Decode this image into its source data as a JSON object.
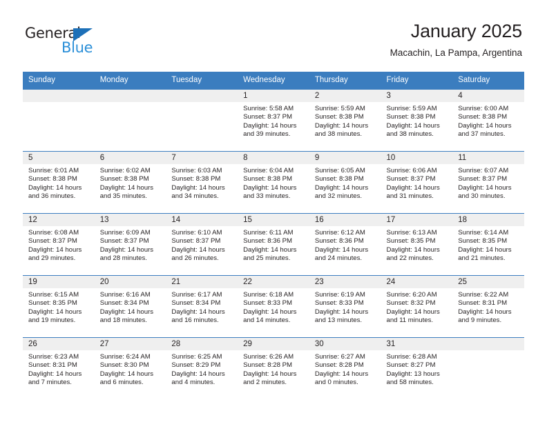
{
  "brand": {
    "name_part1": "General",
    "name_part2": "Blue",
    "triangle_icon": "triangle-icon",
    "color_black": "#231f20",
    "color_blue": "#2b8fd8"
  },
  "header": {
    "title": "January 2025",
    "subtitle": "Macachin, La Pampa, Argentina"
  },
  "theme": {
    "header_bg": "#3b7dbf",
    "header_text": "#ffffff",
    "daynum_bg": "#efefef",
    "cell_bg": "#ffffff",
    "text": "#231f20"
  },
  "weekday_headers": [
    "Sunday",
    "Monday",
    "Tuesday",
    "Wednesday",
    "Thursday",
    "Friday",
    "Saturday"
  ],
  "weeks": [
    [
      {
        "day": "",
        "sunrise": "",
        "sunset": "",
        "daylight": "",
        "empty": true
      },
      {
        "day": "",
        "sunrise": "",
        "sunset": "",
        "daylight": "",
        "empty": true
      },
      {
        "day": "",
        "sunrise": "",
        "sunset": "",
        "daylight": "",
        "empty": true
      },
      {
        "day": "1",
        "sunrise": "Sunrise: 5:58 AM",
        "sunset": "Sunset: 8:37 PM",
        "daylight": "Daylight: 14 hours and 39 minutes."
      },
      {
        "day": "2",
        "sunrise": "Sunrise: 5:59 AM",
        "sunset": "Sunset: 8:38 PM",
        "daylight": "Daylight: 14 hours and 38 minutes."
      },
      {
        "day": "3",
        "sunrise": "Sunrise: 5:59 AM",
        "sunset": "Sunset: 8:38 PM",
        "daylight": "Daylight: 14 hours and 38 minutes."
      },
      {
        "day": "4",
        "sunrise": "Sunrise: 6:00 AM",
        "sunset": "Sunset: 8:38 PM",
        "daylight": "Daylight: 14 hours and 37 minutes."
      }
    ],
    [
      {
        "day": "5",
        "sunrise": "Sunrise: 6:01 AM",
        "sunset": "Sunset: 8:38 PM",
        "daylight": "Daylight: 14 hours and 36 minutes."
      },
      {
        "day": "6",
        "sunrise": "Sunrise: 6:02 AM",
        "sunset": "Sunset: 8:38 PM",
        "daylight": "Daylight: 14 hours and 35 minutes."
      },
      {
        "day": "7",
        "sunrise": "Sunrise: 6:03 AM",
        "sunset": "Sunset: 8:38 PM",
        "daylight": "Daylight: 14 hours and 34 minutes."
      },
      {
        "day": "8",
        "sunrise": "Sunrise: 6:04 AM",
        "sunset": "Sunset: 8:38 PM",
        "daylight": "Daylight: 14 hours and 33 minutes."
      },
      {
        "day": "9",
        "sunrise": "Sunrise: 6:05 AM",
        "sunset": "Sunset: 8:38 PM",
        "daylight": "Daylight: 14 hours and 32 minutes."
      },
      {
        "day": "10",
        "sunrise": "Sunrise: 6:06 AM",
        "sunset": "Sunset: 8:37 PM",
        "daylight": "Daylight: 14 hours and 31 minutes."
      },
      {
        "day": "11",
        "sunrise": "Sunrise: 6:07 AM",
        "sunset": "Sunset: 8:37 PM",
        "daylight": "Daylight: 14 hours and 30 minutes."
      }
    ],
    [
      {
        "day": "12",
        "sunrise": "Sunrise: 6:08 AM",
        "sunset": "Sunset: 8:37 PM",
        "daylight": "Daylight: 14 hours and 29 minutes."
      },
      {
        "day": "13",
        "sunrise": "Sunrise: 6:09 AM",
        "sunset": "Sunset: 8:37 PM",
        "daylight": "Daylight: 14 hours and 28 minutes."
      },
      {
        "day": "14",
        "sunrise": "Sunrise: 6:10 AM",
        "sunset": "Sunset: 8:37 PM",
        "daylight": "Daylight: 14 hours and 26 minutes."
      },
      {
        "day": "15",
        "sunrise": "Sunrise: 6:11 AM",
        "sunset": "Sunset: 8:36 PM",
        "daylight": "Daylight: 14 hours and 25 minutes."
      },
      {
        "day": "16",
        "sunrise": "Sunrise: 6:12 AM",
        "sunset": "Sunset: 8:36 PM",
        "daylight": "Daylight: 14 hours and 24 minutes."
      },
      {
        "day": "17",
        "sunrise": "Sunrise: 6:13 AM",
        "sunset": "Sunset: 8:35 PM",
        "daylight": "Daylight: 14 hours and 22 minutes."
      },
      {
        "day": "18",
        "sunrise": "Sunrise: 6:14 AM",
        "sunset": "Sunset: 8:35 PM",
        "daylight": "Daylight: 14 hours and 21 minutes."
      }
    ],
    [
      {
        "day": "19",
        "sunrise": "Sunrise: 6:15 AM",
        "sunset": "Sunset: 8:35 PM",
        "daylight": "Daylight: 14 hours and 19 minutes."
      },
      {
        "day": "20",
        "sunrise": "Sunrise: 6:16 AM",
        "sunset": "Sunset: 8:34 PM",
        "daylight": "Daylight: 14 hours and 18 minutes."
      },
      {
        "day": "21",
        "sunrise": "Sunrise: 6:17 AM",
        "sunset": "Sunset: 8:34 PM",
        "daylight": "Daylight: 14 hours and 16 minutes."
      },
      {
        "day": "22",
        "sunrise": "Sunrise: 6:18 AM",
        "sunset": "Sunset: 8:33 PM",
        "daylight": "Daylight: 14 hours and 14 minutes."
      },
      {
        "day": "23",
        "sunrise": "Sunrise: 6:19 AM",
        "sunset": "Sunset: 8:33 PM",
        "daylight": "Daylight: 14 hours and 13 minutes."
      },
      {
        "day": "24",
        "sunrise": "Sunrise: 6:20 AM",
        "sunset": "Sunset: 8:32 PM",
        "daylight": "Daylight: 14 hours and 11 minutes."
      },
      {
        "day": "25",
        "sunrise": "Sunrise: 6:22 AM",
        "sunset": "Sunset: 8:31 PM",
        "daylight": "Daylight: 14 hours and 9 minutes."
      }
    ],
    [
      {
        "day": "26",
        "sunrise": "Sunrise: 6:23 AM",
        "sunset": "Sunset: 8:31 PM",
        "daylight": "Daylight: 14 hours and 7 minutes."
      },
      {
        "day": "27",
        "sunrise": "Sunrise: 6:24 AM",
        "sunset": "Sunset: 8:30 PM",
        "daylight": "Daylight: 14 hours and 6 minutes."
      },
      {
        "day": "28",
        "sunrise": "Sunrise: 6:25 AM",
        "sunset": "Sunset: 8:29 PM",
        "daylight": "Daylight: 14 hours and 4 minutes."
      },
      {
        "day": "29",
        "sunrise": "Sunrise: 6:26 AM",
        "sunset": "Sunset: 8:28 PM",
        "daylight": "Daylight: 14 hours and 2 minutes."
      },
      {
        "day": "30",
        "sunrise": "Sunrise: 6:27 AM",
        "sunset": "Sunset: 8:28 PM",
        "daylight": "Daylight: 14 hours and 0 minutes."
      },
      {
        "day": "31",
        "sunrise": "Sunrise: 6:28 AM",
        "sunset": "Sunset: 8:27 PM",
        "daylight": "Daylight: 13 hours and 58 minutes."
      },
      {
        "day": "",
        "sunrise": "",
        "sunset": "",
        "daylight": "",
        "empty": true
      }
    ]
  ]
}
